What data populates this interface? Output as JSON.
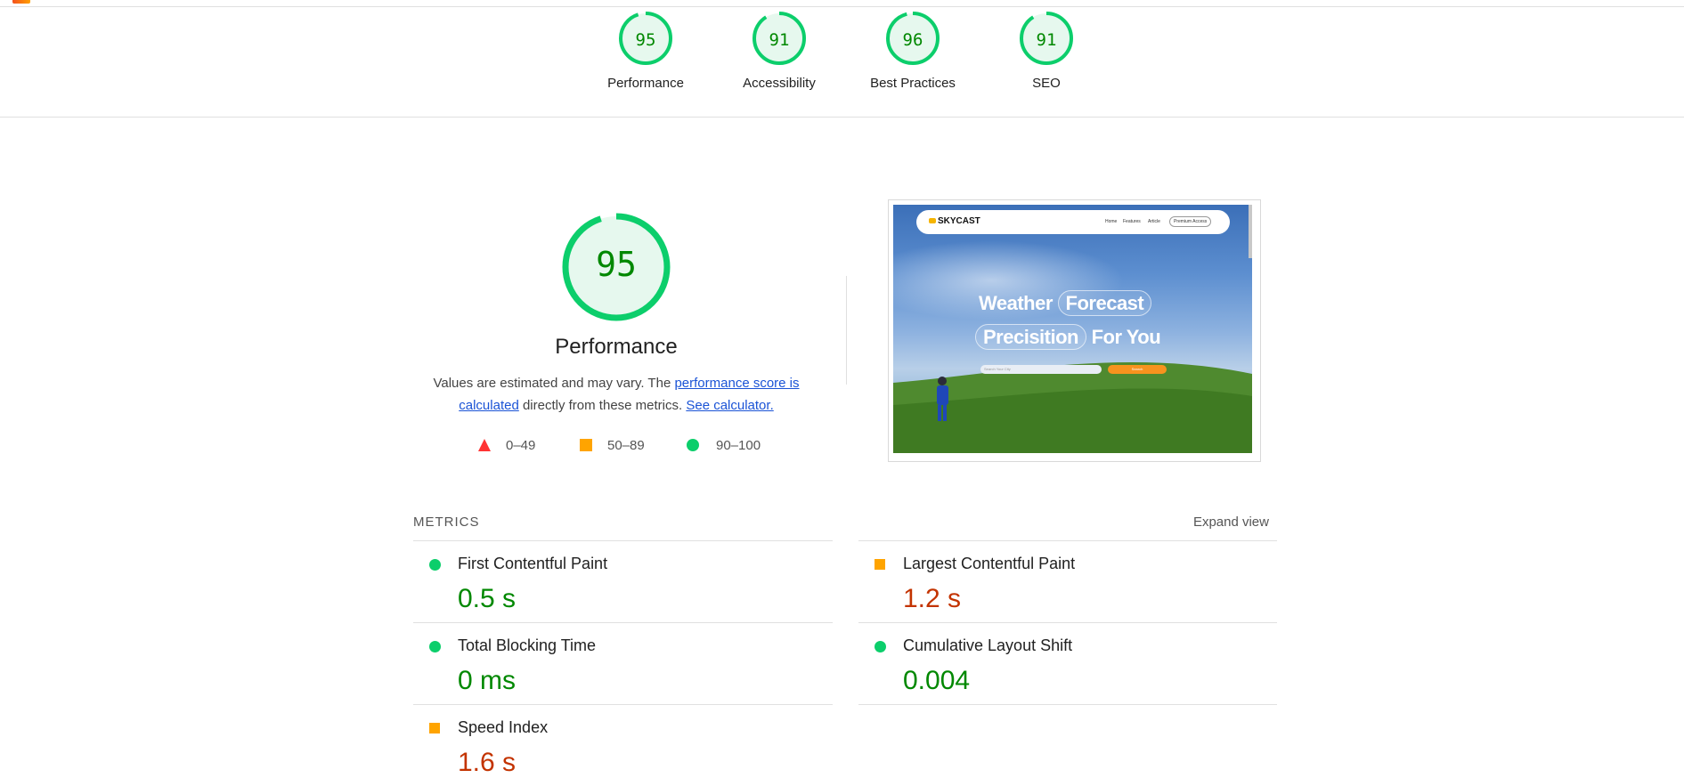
{
  "summary_gauges": [
    {
      "score": "95",
      "label": "Performance",
      "fraction": 0.95
    },
    {
      "score": "91",
      "label": "Accessibility",
      "fraction": 0.91
    },
    {
      "score": "96",
      "label": "Best Practices",
      "fraction": 0.96
    },
    {
      "score": "91",
      "label": "SEO",
      "fraction": 0.91
    }
  ],
  "performance": {
    "score": "95",
    "fraction": 0.95,
    "title": "Performance",
    "desc_text_1": "Values are estimated and may vary. The ",
    "desc_link_1": "performance score is calculated",
    "desc_text_2": " directly from these metrics. ",
    "desc_link_2": "See calculator.",
    "legend": [
      {
        "range": "0–49",
        "shape": "triangle",
        "color": "#ff3333"
      },
      {
        "range": "50–89",
        "shape": "square",
        "color": "#ffa400"
      },
      {
        "range": "90–100",
        "shape": "circle",
        "color": "#0cce6b"
      }
    ]
  },
  "screenshot": {
    "brand": "SKYCAST",
    "nav": [
      "Home",
      "Features",
      "Article"
    ],
    "premium": "Premium Access",
    "hero_line1_a": "Weather",
    "hero_line1_b": "Forecast",
    "hero_line2_a": "Precisition",
    "hero_line2_b": "For You",
    "input_placeholder": "Search Your City",
    "button": "Search"
  },
  "metrics": {
    "title": "METRICS",
    "expand": "Expand view",
    "items": [
      {
        "name": "First Contentful Paint",
        "value": "0.5 s",
        "rating": "pass"
      },
      {
        "name": "Largest Contentful Paint",
        "value": "1.2 s",
        "rating": "average"
      },
      {
        "name": "Total Blocking Time",
        "value": "0 ms",
        "rating": "pass"
      },
      {
        "name": "Cumulative Layout Shift",
        "value": "0.004",
        "rating": "pass"
      },
      {
        "name": "Speed Index",
        "value": "1.6 s",
        "rating": "average"
      }
    ]
  },
  "colors": {
    "pass": "#0cce6b",
    "pass_text": "#008800",
    "average": "#ffa400",
    "average_text": "#c33300",
    "fail": "#ff3333",
    "link": "#1a53d6"
  }
}
